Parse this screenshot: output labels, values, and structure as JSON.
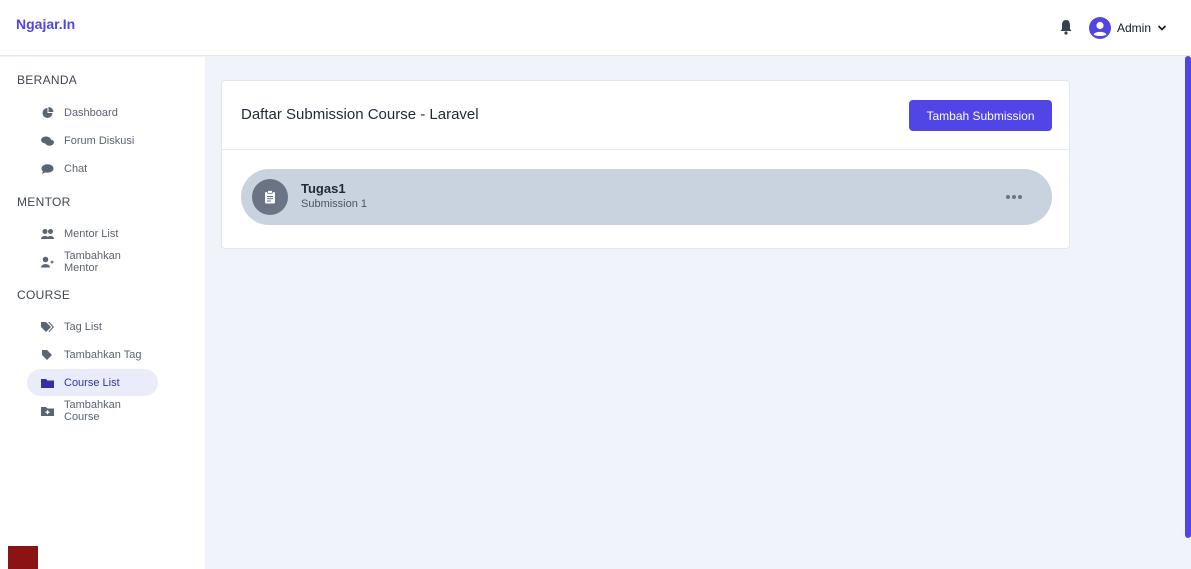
{
  "brand": "Ngajar.In",
  "header": {
    "user_name": "Admin"
  },
  "sidebar": {
    "sections": [
      {
        "label": "BERANDA",
        "items": [
          {
            "label": "Dashboard",
            "icon": "pie-chart-icon"
          },
          {
            "label": "Forum Diskusi",
            "icon": "comments-icon"
          },
          {
            "label": "Chat",
            "icon": "comment-icon"
          }
        ]
      },
      {
        "label": "MENTOR",
        "items": [
          {
            "label": "Mentor List",
            "icon": "users-icon"
          },
          {
            "label": "Tambahkan Mentor",
            "icon": "user-plus-icon"
          }
        ]
      },
      {
        "label": "COURSE",
        "items": [
          {
            "label": "Tag List",
            "icon": "tags-icon"
          },
          {
            "label": "Tambahkan Tag",
            "icon": "tag-icon"
          },
          {
            "label": "Course List",
            "icon": "folder-icon",
            "active": true
          },
          {
            "label": "Tambahkan Course",
            "icon": "folder-plus-icon"
          }
        ]
      }
    ]
  },
  "main": {
    "title": "Daftar Submission Course - Laravel",
    "add_button_label": "Tambah Submission",
    "submissions": [
      {
        "title": "Tugas1",
        "description": "Submission 1",
        "icon": "clipboard-icon"
      }
    ]
  },
  "colors": {
    "accent": "#4f46e5",
    "background": "#f0f3fa",
    "active_item": "#eaedf9",
    "submission_bg": "#c9d2df"
  }
}
